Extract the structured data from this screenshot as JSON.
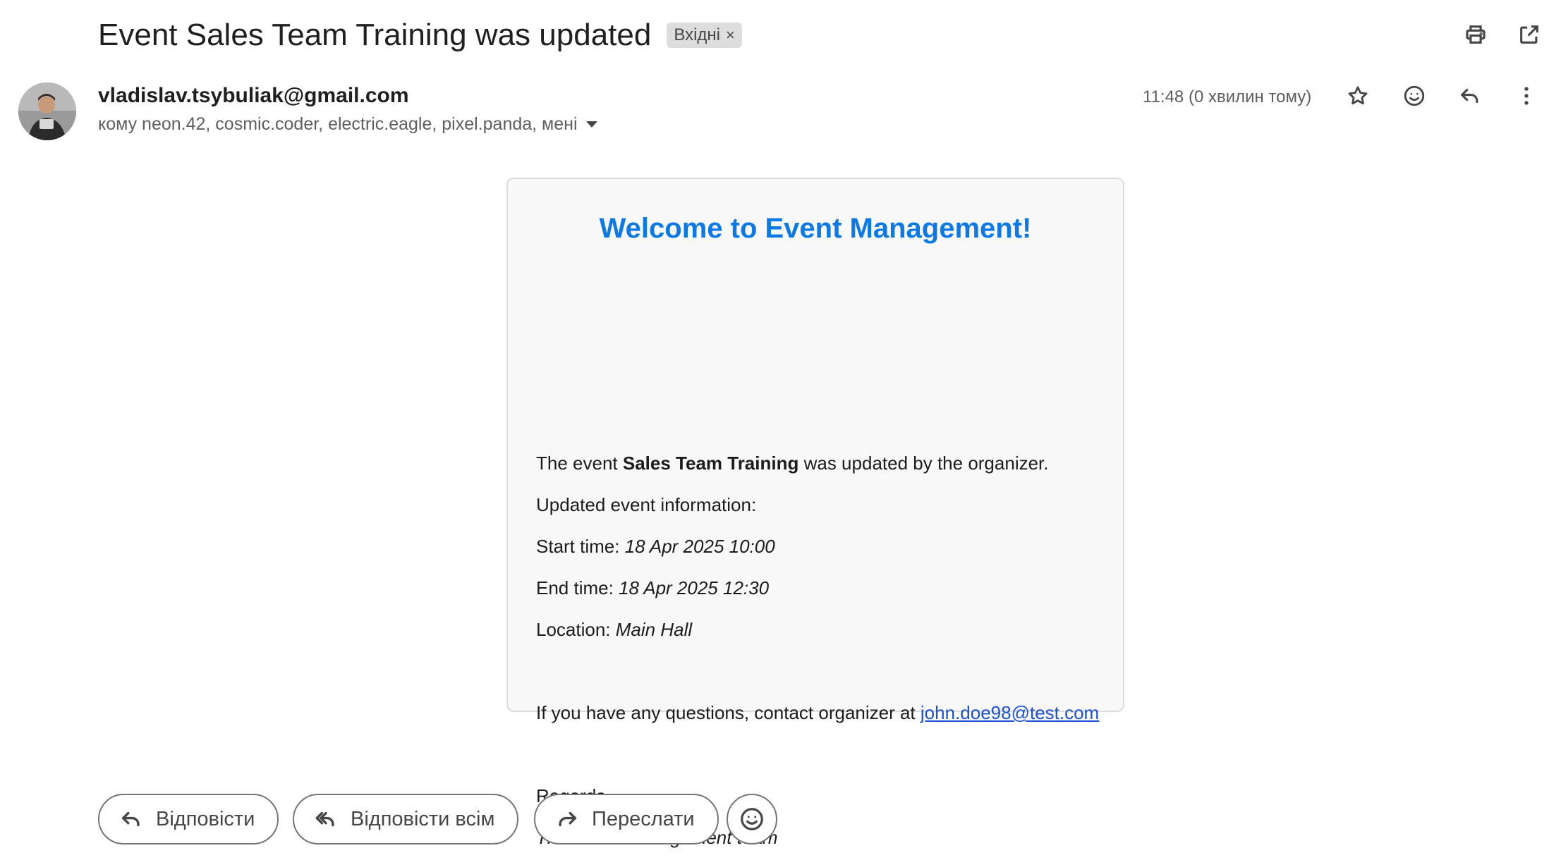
{
  "subject": {
    "title": "Event Sales Team Training was updated",
    "label": "Вхідні",
    "label_remove": "×"
  },
  "sender": {
    "email": "vladislav.tsybuliak@gmail.com",
    "recipients": "кому neon.42, cosmic.coder, electric.eagle, pixel.panda, мені",
    "time": "11:48 (0 хвилин тому)"
  },
  "message": {
    "heading": "Welcome to Event Management!",
    "intro_prefix": "The event ",
    "event_name": "Sales Team Training",
    "intro_suffix": " was updated by the organizer.",
    "updated_label": "Updated event information:",
    "start_label": "Start time: ",
    "start_value": "18 Apr 2025 10:00",
    "end_label": "End time: ",
    "end_value": "18 Apr 2025 12:30",
    "location_label": "Location: ",
    "location_value": "Main Hall",
    "questions_text": "If you have any questions, contact organizer at ",
    "organizer_email": "john.doe98@test.com",
    "regards": "Regards,",
    "signature": "The Event Management team"
  },
  "actions": {
    "reply": "Відповісти",
    "reply_all": "Відповісти всім",
    "forward": "Переслати"
  },
  "icons": {
    "print": "print-icon",
    "open_new_window": "open-in-new-window-icon",
    "star": "star-icon",
    "emoji": "emoji-icon",
    "reply": "reply-icon",
    "more": "more-vertical-icon"
  },
  "colors": {
    "heading": "#0d79e4",
    "link": "#1a4fd6",
    "card_bg": "#f8f8f8",
    "label_chip_bg": "#dddddd"
  }
}
